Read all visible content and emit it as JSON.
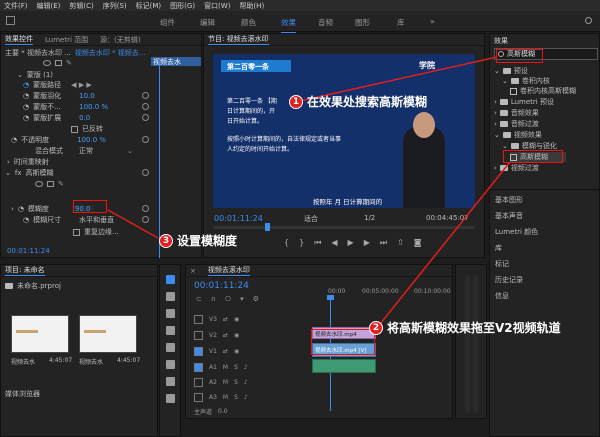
{
  "menu": [
    "文件(F)",
    "编辑(E)",
    "剪辑(C)",
    "序列(S)",
    "标记(M)",
    "图形(G)",
    "窗口(W)",
    "帮助(H)"
  ],
  "workspaces": [
    "组件",
    "编辑",
    "颜色",
    "效果",
    "音频",
    "图形",
    "库"
  ],
  "workspace_active": "效果",
  "effect_controls": {
    "tabs": [
      "效果控件",
      "Lumetri 范围",
      "源：(无剪辑)"
    ],
    "clip_path": "主要 * 视频去水印 ...",
    "seq_path": "视频去水印 * 视频去...",
    "clip_badge": "视频去水",
    "rows": {
      "mask_path": "蒙版路径",
      "mask_feather_label": "蒙版羽化",
      "mask_feather_value": "10.0",
      "mask_opacity_label": "蒙版不...",
      "mask_opacity_value": "100.0 %",
      "mask_expand_label": "蒙版扩展",
      "mask_expand_value": "0.0",
      "inverted_label": "已反转",
      "opacity_label": "不透明度",
      "opacity_value": "100.0 %",
      "blend_label": "混合模式",
      "blend_value": "正常",
      "time_remap": "时间重映射",
      "blur_effect": "高斯模糊",
      "blurriness_label": "模糊度",
      "blurriness_value": "90.0",
      "dimensions_label": "模糊尺寸",
      "dimensions_value": "水平和垂直",
      "repeat_edge_label": "重复边缘..."
    },
    "timecode": "00:01:11:24",
    "header_mask": "蒙版 (1)",
    "fx_label": "fx"
  },
  "program": {
    "title": "节目: 视频去滚水印",
    "timecode": "00:01:11:24",
    "fit": "适合",
    "ratio": "1/2",
    "duration": "00:04:45:07",
    "video_banner": "第二百零一条",
    "video_text1": "第二百零一条 【期",
    "video_text2": "日计算期间的，开",
    "video_text3": "日开始计算。",
    "video_text4": "按照小时计算期间的，自法律规定或者当事",
    "video_text5": "人约定的时间开始计算。",
    "video_caption": "按照年 月 日计算期间的",
    "logo_text": "学院"
  },
  "effects_panel": {
    "title": "效果",
    "search_value": "高斯模糊",
    "tree": [
      "预设",
      "卷积内核",
      "卷积内核高斯模糊",
      "Lumetri 预设",
      "音频效果",
      "音频过渡",
      "视频效果",
      "模糊与锐化",
      "高斯模糊",
      "视频过渡"
    ],
    "side_items": [
      "基本图形",
      "基本声音",
      "Lumetri 颜色",
      "库",
      "标记",
      "历史记录",
      "信息"
    ]
  },
  "project": {
    "title": "项目: 未命名",
    "file": "未命名.prproj",
    "thumb1_label": "视频去水",
    "thumb1_time": "4:45:07",
    "thumb2_label": "视频去水",
    "thumb2_time": "4:45:07",
    "media_browser": "媒体浏览器"
  },
  "timeline": {
    "title": "视频去滚水印",
    "timecode": "00:01:11:24",
    "ruler_marks": [
      "00:00",
      "00:05:00:00",
      "00:10:00:00"
    ],
    "tracks": [
      "V3",
      "V2",
      "V1",
      "A1",
      "A2",
      "A3"
    ],
    "master": "主声道",
    "master_value": "0.0",
    "clip_v2": "视频去水印.mp4",
    "clip_v1": "视频去水印.mp4 [V]",
    "ms": [
      "M",
      "S"
    ]
  },
  "annotations": {
    "step1": "在效果处搜索高斯模糊",
    "step2": "将高斯模糊效果拖至V2视频轨道",
    "step3": "设置模糊度",
    "n1": "1",
    "n2": "2",
    "n3": "3"
  },
  "colors": {
    "accent": "#3c8df0",
    "annotation": "#e11d1d"
  }
}
